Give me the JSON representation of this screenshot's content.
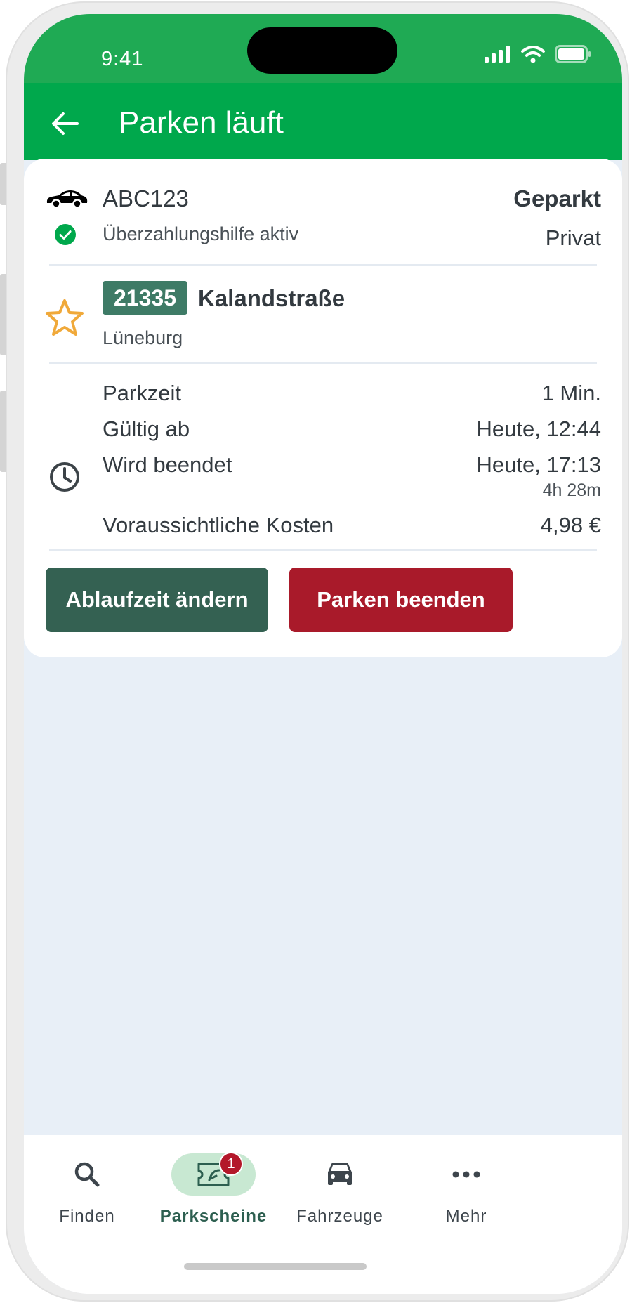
{
  "status_bar": {
    "time": "9:41"
  },
  "app_bar": {
    "title": "Parken läuft"
  },
  "vehicle": {
    "plate": "ABC123",
    "overpay_help": "Überzahlungshilfe aktiv",
    "status": "Geparkt",
    "type": "Privat"
  },
  "zone": {
    "number": "21335",
    "street": "Kalandstraße",
    "city": "Lüneburg"
  },
  "parking": {
    "duration_label": "Parkzeit",
    "duration_value": "1 Min.",
    "valid_from_label": "Gültig ab",
    "valid_from_value": "Heute, 12:44",
    "ends_label": "Wird beendet",
    "ends_value": "Heute, 17:13",
    "remaining": "4h 28m",
    "cost_label": "Voraussichtliche Kosten",
    "cost_value": "4,98 €"
  },
  "actions": {
    "change_label": "Ablaufzeit ändern",
    "end_label": "Parken beenden"
  },
  "nav": {
    "items": [
      {
        "label": "Finden"
      },
      {
        "label": "Parkscheine",
        "badge": "1"
      },
      {
        "label": "Fahrzeuge"
      },
      {
        "label": "Mehr"
      }
    ]
  },
  "colors": {
    "brand_green": "#00a84c",
    "zone_badge": "#3e7b66",
    "change_button": "#346152",
    "end_button": "#a91a2a",
    "favorite_star": "#f0a93a"
  }
}
